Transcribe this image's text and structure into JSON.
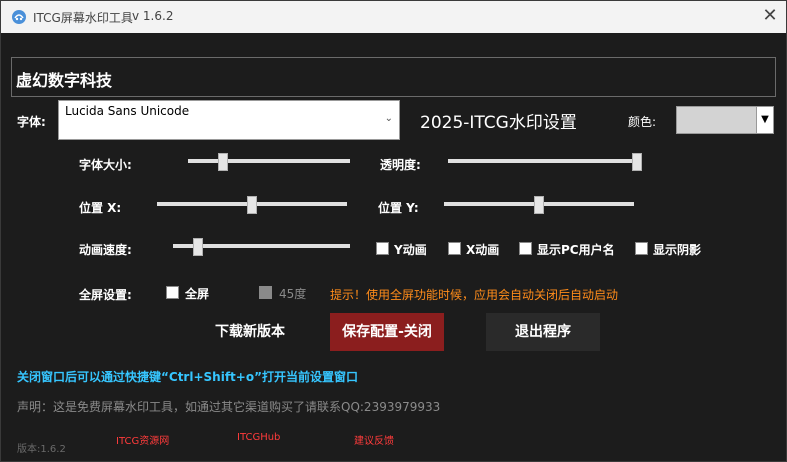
{
  "titlebar": {
    "title": "ITCG屏幕水印工具",
    "version": "v 1.6.2",
    "close_symbol": "✕"
  },
  "watermark_text": "虚幻数字科技",
  "font": {
    "label": "字体:",
    "selected": "Lucida Sans Unicode"
  },
  "settings_title": "2025-ITCG水印设置",
  "color": {
    "label": "颜色:",
    "value": "#d3d3d3"
  },
  "sliders": {
    "font_size": {
      "label": "字体大小:",
      "value_fraction": 0.2
    },
    "opacity": {
      "label": "透明度:",
      "value_fraction": 1.0
    },
    "pos_x": {
      "label": "位置   X:",
      "value_fraction": 0.5
    },
    "pos_y": {
      "label": "位置 Y:",
      "value_fraction": 0.5
    },
    "anim_speed": {
      "label": "动画速度:",
      "value_fraction": 0.12
    }
  },
  "checkboxes": {
    "y_anim": {
      "label": "Y动画",
      "checked": false
    },
    "x_anim": {
      "label": "X动画",
      "checked": false
    },
    "show_pc_user": {
      "label": "显示PC用户名",
      "checked": false
    },
    "show_shadow": {
      "label": "显示阴影",
      "checked": false
    }
  },
  "fullscreen": {
    "label": "全屏设置:",
    "fullscreen_label": "全屏",
    "angle_label": "45度",
    "hint": "提示！使用全屏功能时候，应用会自动关闭后自动启动"
  },
  "buttons": {
    "download": "下载新版本",
    "save_close": "保存配置-关闭",
    "exit": "退出程序"
  },
  "shortcut_note": "关闭窗口后可以通过快捷键“Ctrl+Shift+o”打开当前设置窗口",
  "disclaimer": "声明：这是免费屏幕水印工具，如通过其它渠道购买了请联系QQ:2393979933",
  "footer": {
    "version": "版本:1.6.2",
    "links": [
      "ITCG资源网",
      "ITCGHub",
      "建议反馈"
    ]
  },
  "colors": {
    "background": "#1c1c1c",
    "save_button": "#8b1e1e",
    "hint": "#ff8c1a",
    "shortcut_note": "#36c6ff",
    "link": "#ff3b3b"
  }
}
